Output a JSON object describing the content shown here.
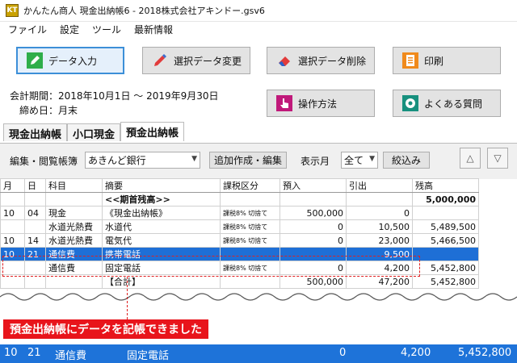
{
  "window": {
    "icon_text": "KT",
    "title": "かんたん商人 現金出納帳6 - 2018株式会社アキンドー.gsv6"
  },
  "menu": [
    "ファイル",
    "設定",
    "ツール",
    "最新情報"
  ],
  "toolbar": {
    "data_entry": "データ入力",
    "change_data": "選択データ変更",
    "delete_data": "選択データ削除",
    "print": "印刷",
    "how_to": "操作方法",
    "faq": "よくある質問"
  },
  "period": {
    "fiscal": "会計期間：2018年10月1日 ～ 2019年9月30日",
    "closing": "締め日：月末"
  },
  "tabs": [
    "現金出納帳",
    "小口現金",
    "預金出納帳"
  ],
  "filter": {
    "book_label": "編集・閲覧帳簿",
    "book_value": "あきんど銀行",
    "add_edit": "追加作成・編集",
    "month_label": "表示月",
    "month_value": "全て",
    "narrow": "絞込み"
  },
  "colors": {
    "accent": "#1e6fd6",
    "banner": "#e8141b"
  },
  "table": {
    "headers": [
      "月",
      "日",
      "科目",
      "摘要",
      "課税区分",
      "預入",
      "引出",
      "残高"
    ],
    "rows": [
      {
        "m": "",
        "d": "",
        "acct": "",
        "memo": "<<期首残高>>",
        "tax": "",
        "dep": "",
        "wd": "",
        "bal": "5,000,000",
        "bold": true
      },
      {
        "m": "10",
        "d": "04",
        "acct": "現金",
        "memo": "《現金出納帳》",
        "tax": "課税8% 切捨て",
        "dep": "500,000",
        "wd": "0",
        "bal": ""
      },
      {
        "m": "",
        "d": "",
        "acct": "水道光熱費",
        "memo": "水道代",
        "tax": "課税8% 切捨て",
        "dep": "0",
        "wd": "10,500",
        "bal": "5,489,500"
      },
      {
        "m": "10",
        "d": "14",
        "acct": "水道光熱費",
        "memo": "電気代",
        "tax": "課税8% 切捨て",
        "dep": "0",
        "wd": "23,000",
        "bal": "5,466,500"
      },
      {
        "m": "10",
        "d": "21",
        "acct": "通信費",
        "memo": "携帯電話",
        "tax": "",
        "dep": "",
        "wd": "9,500",
        "bal": "",
        "hl": true
      },
      {
        "m": "",
        "d": "",
        "acct": "通信費",
        "memo": "固定電話",
        "tax": "課税8% 切捨て",
        "dep": "0",
        "wd": "4,200",
        "bal": "5,452,800"
      },
      {
        "m": "",
        "d": "",
        "acct": "",
        "memo": "【合計】",
        "tax": "",
        "dep": "500,000",
        "wd": "47,200",
        "bal": "5,452,800"
      }
    ]
  },
  "banner": "預金出納帳にデータを記帳できました",
  "zoom_row": {
    "m": "10",
    "d": "21",
    "acct": "通信費",
    "memo": "固定電話",
    "dep": "0",
    "wd": "4,200",
    "bal": "5,452,800"
  }
}
